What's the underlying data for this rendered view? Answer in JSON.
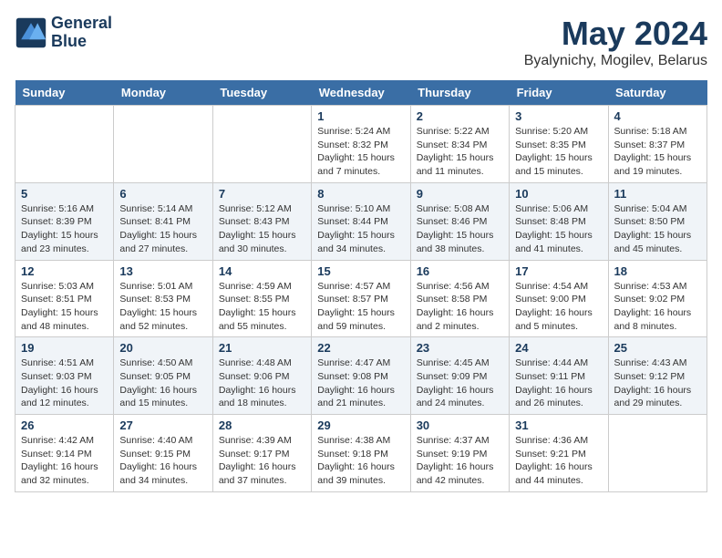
{
  "logo": {
    "line1": "General",
    "line2": "Blue"
  },
  "title": "May 2024",
  "location": "Byalynichy, Mogilev, Belarus",
  "days_of_week": [
    "Sunday",
    "Monday",
    "Tuesday",
    "Wednesday",
    "Thursday",
    "Friday",
    "Saturday"
  ],
  "weeks": [
    [
      {
        "day": "",
        "sunrise": "",
        "sunset": "",
        "daylight": ""
      },
      {
        "day": "",
        "sunrise": "",
        "sunset": "",
        "daylight": ""
      },
      {
        "day": "",
        "sunrise": "",
        "sunset": "",
        "daylight": ""
      },
      {
        "day": "1",
        "sunrise": "Sunrise: 5:24 AM",
        "sunset": "Sunset: 8:32 PM",
        "daylight": "Daylight: 15 hours and 7 minutes."
      },
      {
        "day": "2",
        "sunrise": "Sunrise: 5:22 AM",
        "sunset": "Sunset: 8:34 PM",
        "daylight": "Daylight: 15 hours and 11 minutes."
      },
      {
        "day": "3",
        "sunrise": "Sunrise: 5:20 AM",
        "sunset": "Sunset: 8:35 PM",
        "daylight": "Daylight: 15 hours and 15 minutes."
      },
      {
        "day": "4",
        "sunrise": "Sunrise: 5:18 AM",
        "sunset": "Sunset: 8:37 PM",
        "daylight": "Daylight: 15 hours and 19 minutes."
      }
    ],
    [
      {
        "day": "5",
        "sunrise": "Sunrise: 5:16 AM",
        "sunset": "Sunset: 8:39 PM",
        "daylight": "Daylight: 15 hours and 23 minutes."
      },
      {
        "day": "6",
        "sunrise": "Sunrise: 5:14 AM",
        "sunset": "Sunset: 8:41 PM",
        "daylight": "Daylight: 15 hours and 27 minutes."
      },
      {
        "day": "7",
        "sunrise": "Sunrise: 5:12 AM",
        "sunset": "Sunset: 8:43 PM",
        "daylight": "Daylight: 15 hours and 30 minutes."
      },
      {
        "day": "8",
        "sunrise": "Sunrise: 5:10 AM",
        "sunset": "Sunset: 8:44 PM",
        "daylight": "Daylight: 15 hours and 34 minutes."
      },
      {
        "day": "9",
        "sunrise": "Sunrise: 5:08 AM",
        "sunset": "Sunset: 8:46 PM",
        "daylight": "Daylight: 15 hours and 38 minutes."
      },
      {
        "day": "10",
        "sunrise": "Sunrise: 5:06 AM",
        "sunset": "Sunset: 8:48 PM",
        "daylight": "Daylight: 15 hours and 41 minutes."
      },
      {
        "day": "11",
        "sunrise": "Sunrise: 5:04 AM",
        "sunset": "Sunset: 8:50 PM",
        "daylight": "Daylight: 15 hours and 45 minutes."
      }
    ],
    [
      {
        "day": "12",
        "sunrise": "Sunrise: 5:03 AM",
        "sunset": "Sunset: 8:51 PM",
        "daylight": "Daylight: 15 hours and 48 minutes."
      },
      {
        "day": "13",
        "sunrise": "Sunrise: 5:01 AM",
        "sunset": "Sunset: 8:53 PM",
        "daylight": "Daylight: 15 hours and 52 minutes."
      },
      {
        "day": "14",
        "sunrise": "Sunrise: 4:59 AM",
        "sunset": "Sunset: 8:55 PM",
        "daylight": "Daylight: 15 hours and 55 minutes."
      },
      {
        "day": "15",
        "sunrise": "Sunrise: 4:57 AM",
        "sunset": "Sunset: 8:57 PM",
        "daylight": "Daylight: 15 hours and 59 minutes."
      },
      {
        "day": "16",
        "sunrise": "Sunrise: 4:56 AM",
        "sunset": "Sunset: 8:58 PM",
        "daylight": "Daylight: 16 hours and 2 minutes."
      },
      {
        "day": "17",
        "sunrise": "Sunrise: 4:54 AM",
        "sunset": "Sunset: 9:00 PM",
        "daylight": "Daylight: 16 hours and 5 minutes."
      },
      {
        "day": "18",
        "sunrise": "Sunrise: 4:53 AM",
        "sunset": "Sunset: 9:02 PM",
        "daylight": "Daylight: 16 hours and 8 minutes."
      }
    ],
    [
      {
        "day": "19",
        "sunrise": "Sunrise: 4:51 AM",
        "sunset": "Sunset: 9:03 PM",
        "daylight": "Daylight: 16 hours and 12 minutes."
      },
      {
        "day": "20",
        "sunrise": "Sunrise: 4:50 AM",
        "sunset": "Sunset: 9:05 PM",
        "daylight": "Daylight: 16 hours and 15 minutes."
      },
      {
        "day": "21",
        "sunrise": "Sunrise: 4:48 AM",
        "sunset": "Sunset: 9:06 PM",
        "daylight": "Daylight: 16 hours and 18 minutes."
      },
      {
        "day": "22",
        "sunrise": "Sunrise: 4:47 AM",
        "sunset": "Sunset: 9:08 PM",
        "daylight": "Daylight: 16 hours and 21 minutes."
      },
      {
        "day": "23",
        "sunrise": "Sunrise: 4:45 AM",
        "sunset": "Sunset: 9:09 PM",
        "daylight": "Daylight: 16 hours and 24 minutes."
      },
      {
        "day": "24",
        "sunrise": "Sunrise: 4:44 AM",
        "sunset": "Sunset: 9:11 PM",
        "daylight": "Daylight: 16 hours and 26 minutes."
      },
      {
        "day": "25",
        "sunrise": "Sunrise: 4:43 AM",
        "sunset": "Sunset: 9:12 PM",
        "daylight": "Daylight: 16 hours and 29 minutes."
      }
    ],
    [
      {
        "day": "26",
        "sunrise": "Sunrise: 4:42 AM",
        "sunset": "Sunset: 9:14 PM",
        "daylight": "Daylight: 16 hours and 32 minutes."
      },
      {
        "day": "27",
        "sunrise": "Sunrise: 4:40 AM",
        "sunset": "Sunset: 9:15 PM",
        "daylight": "Daylight: 16 hours and 34 minutes."
      },
      {
        "day": "28",
        "sunrise": "Sunrise: 4:39 AM",
        "sunset": "Sunset: 9:17 PM",
        "daylight": "Daylight: 16 hours and 37 minutes."
      },
      {
        "day": "29",
        "sunrise": "Sunrise: 4:38 AM",
        "sunset": "Sunset: 9:18 PM",
        "daylight": "Daylight: 16 hours and 39 minutes."
      },
      {
        "day": "30",
        "sunrise": "Sunrise: 4:37 AM",
        "sunset": "Sunset: 9:19 PM",
        "daylight": "Daylight: 16 hours and 42 minutes."
      },
      {
        "day": "31",
        "sunrise": "Sunrise: 4:36 AM",
        "sunset": "Sunset: 9:21 PM",
        "daylight": "Daylight: 16 hours and 44 minutes."
      },
      {
        "day": "",
        "sunrise": "",
        "sunset": "",
        "daylight": ""
      }
    ]
  ]
}
